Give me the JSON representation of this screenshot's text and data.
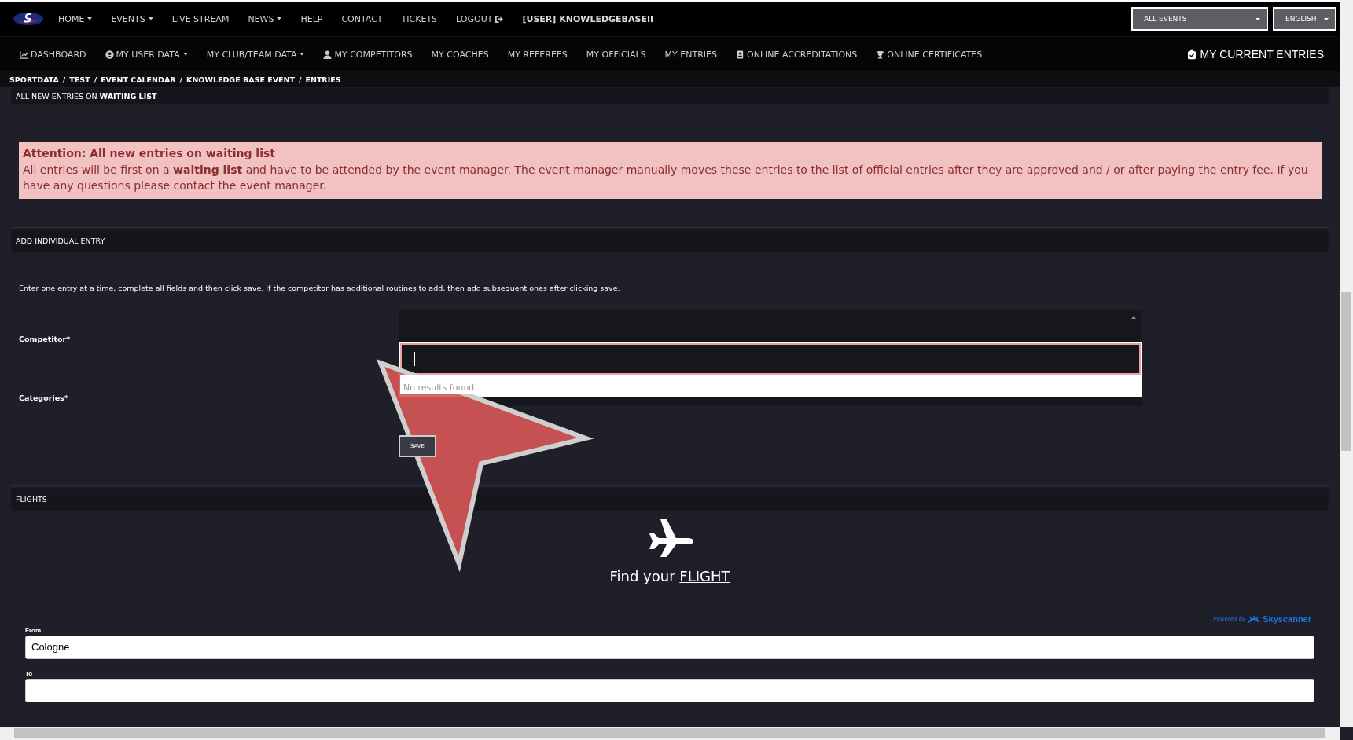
{
  "top_nav": {
    "items": [
      {
        "label": "HOME",
        "dropdown": true,
        "kind": "plain"
      },
      {
        "label": "EVENTS",
        "dropdown": true,
        "kind": "plain"
      },
      {
        "label": "LIVE STREAM",
        "dropdown": false,
        "kind": "plain"
      },
      {
        "label": "NEWS",
        "dropdown": true,
        "kind": "plain"
      },
      {
        "label": "HELP",
        "dropdown": false,
        "kind": "plain"
      },
      {
        "label": "CONTACT",
        "dropdown": false,
        "kind": "plain"
      },
      {
        "label": "TICKETS",
        "dropdown": false,
        "kind": "plain"
      },
      {
        "label": "LOGOUT",
        "dropdown": false,
        "kind": "logout"
      }
    ],
    "user": "[USER] KNOWLEDGEBASEII",
    "event_select": "ALL EVENTS",
    "language": "ENGLISH"
  },
  "sub_nav": {
    "items": [
      {
        "label": "DASHBOARD",
        "dropdown": false,
        "kind": "chart"
      },
      {
        "label": "MY USER DATA",
        "dropdown": true,
        "kind": "usercircle"
      },
      {
        "label": "MY CLUB/TEAM DATA",
        "dropdown": true,
        "kind": "plain"
      },
      {
        "label": "MY COMPETITORS",
        "dropdown": false,
        "kind": "person"
      },
      {
        "label": "MY COACHES",
        "dropdown": false,
        "kind": "plain"
      },
      {
        "label": "MY REFEREES",
        "dropdown": false,
        "kind": "plain"
      },
      {
        "label": "MY OFFICIALS",
        "dropdown": false,
        "kind": "plain"
      },
      {
        "label": "MY ENTRIES",
        "dropdown": false,
        "kind": "plain"
      },
      {
        "label": "ONLINE ACCREDITATIONS",
        "dropdown": false,
        "kind": "badge"
      },
      {
        "label": "ONLINE CERTIFICATES",
        "dropdown": false,
        "kind": "trophy"
      }
    ],
    "current_entries": "MY CURRENT ENTRIES"
  },
  "breadcrumb": {
    "separator": "/",
    "items": [
      "SPORTDATA",
      "TEST",
      "EVENT CALENDAR",
      "KNOWLEDGE BASE EVENT",
      "ENTRIES"
    ]
  },
  "waiting_section": {
    "title": "ALL NEW ENTRIES ON **WAITING LIST**"
  },
  "alert": {
    "title": "Attention: All new entries on waiting list",
    "text": "All entries will be first on a **waiting list** and have to be attended by the event manager. The event manager manually moves these entries to the list of official entries after they are approved and / or after paying the entry fee. If you have any questions please contact the event manager."
  },
  "entry_form": {
    "title": "ADD INDIVIDUAL ENTRY",
    "instructions": "Enter one entry at a time, complete all fields and then click save. If the competitor has additional routines to add, then add subsequent ones after clicking save.",
    "fields": [
      {
        "label": "Competitor*"
      },
      {
        "label": "Categories*"
      }
    ],
    "no_results": "No results found",
    "save": "SAVE"
  },
  "flights": {
    "title": "FLIGHTS",
    "heading": "Find your",
    "link": "FLIGHT",
    "powered_by": "Powered by",
    "brand": "Skyscanner",
    "fields": [
      {
        "label": "From",
        "value": "Cologne"
      },
      {
        "label": "To"
      }
    ]
  }
}
